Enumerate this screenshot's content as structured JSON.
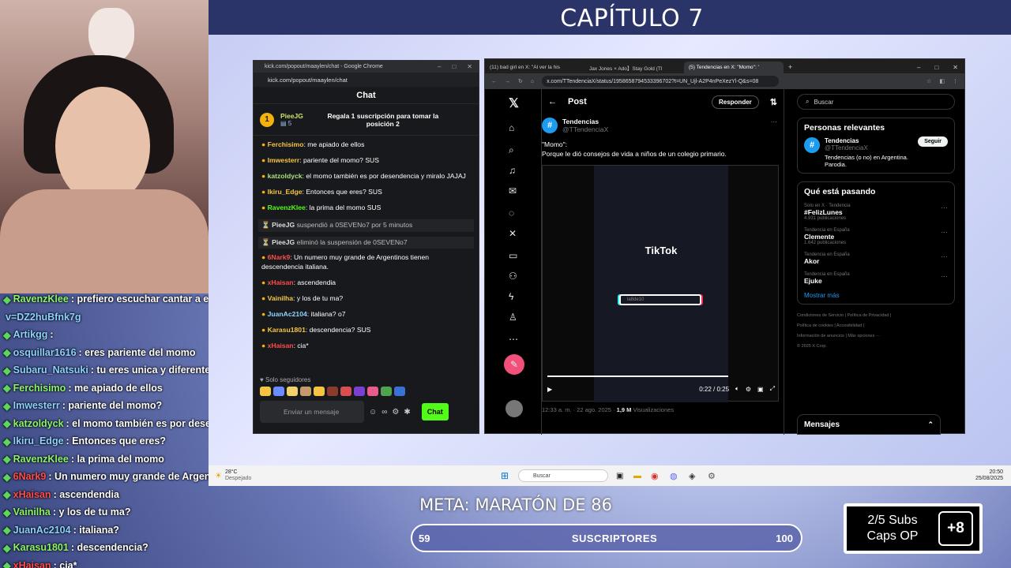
{
  "overlay": {
    "chapter": "CAPÍTULO 7",
    "goal_title": "META: MARATÓN DE 86",
    "goal_current": "59",
    "goal_label": "SUSCRIPTORES",
    "goal_target": "100",
    "goal_progress": 0.59,
    "subs_line1": "2/5 Subs",
    "subs_line2": "Caps OP",
    "subs_plus": "+8"
  },
  "stream_chat": [
    {
      "user": "RavenzKlee",
      "text": ": prefiero escuchar cantar a este",
      "color": "green"
    },
    {
      "user": "v=DZ2huBfnk7g",
      "text": "",
      "color": "plain"
    },
    {
      "user": "Artikgg",
      "text": ":",
      "color": "blue"
    },
    {
      "user": "osquillar1616",
      "text": ": eres pariente del momo",
      "color": "blue"
    },
    {
      "user": "Subaru_Natsuki",
      "text": ": tu eres unica y diferente",
      "color": "blue"
    },
    {
      "user": "Ferchisimo",
      "text": ": me apiado de ellos",
      "color": "green"
    },
    {
      "user": "Imwesterr",
      "text": ": pariente del momo?",
      "color": "blue"
    },
    {
      "user": "katzoldyck",
      "text": ": el momo también es por deser",
      "color": "green"
    },
    {
      "user": "Ikiru_Edge",
      "text": ": Entonces que eres?",
      "color": "blue"
    },
    {
      "user": "RavenzKlee",
      "text": ": la prima del momo",
      "color": "green"
    },
    {
      "user": "6Nark9",
      "text": ": Un numero muy grande de Argentino",
      "color": "red"
    },
    {
      "user": "xHaisan",
      "text": ": ascendendia",
      "color": "red"
    },
    {
      "user": "Vainilha",
      "text": ": y los de tu ma?",
      "color": "green"
    },
    {
      "user": "JuanAc2104",
      "text": ": italiana?",
      "color": "blue"
    },
    {
      "user": "Karasu1801",
      "text": ": descendencia?",
      "color": "green"
    },
    {
      "user": "xHaisan",
      "text": ": cia*",
      "color": "red"
    }
  ],
  "kick": {
    "window_title": "kick.com/popout/maaylen/chat - Google Chrome",
    "url": "kick.com/popout/maaylen/chat",
    "header": "Chat",
    "pinned_user": "PieeJG",
    "pinned_count": "5",
    "pinned_rank": "1",
    "gift_text": "Regala 1 suscripción para tomar la posición 2",
    "messages": [
      {
        "user": "Ferchisimo",
        "text": ": me apiado de ellos",
        "color": "#f5c542",
        "sys": false
      },
      {
        "user": "Imwesterr",
        "text": ": pariente del momo? SUS",
        "color": "#f5c542",
        "sys": false
      },
      {
        "user": "katzoldyck",
        "text": ": el momo también es por desendencia y miralo JAJAJ",
        "color": "#a6e07a",
        "sys": false
      },
      {
        "user": "Ikiru_Edge",
        "text": ": Entonces que eres? SUS",
        "color": "#f5c542",
        "sys": false
      },
      {
        "user": "RavenzKlee",
        "text": ": la prima del momo SUS",
        "color": "#53fc18",
        "sys": false
      },
      {
        "user": "PieeJG",
        "text": " suspendió a 0SEVENo7 por 5 minutos",
        "color": "#ddd",
        "sys": true
      },
      {
        "user": "PieeJG",
        "text": " eliminó la suspensión de 0SEVENo7",
        "color": "#ddd",
        "sys": true
      },
      {
        "user": "6Nark9",
        "text": ": Un numero muy grande de Argentinos tienen descendencia italiana.",
        "color": "#ff4d4d",
        "sys": false
      },
      {
        "user": "xHaisan",
        "text": ": ascendendia",
        "color": "#ff4d4d",
        "sys": false
      },
      {
        "user": "Vainilha",
        "text": ": y los de tu ma?",
        "color": "#f5c542",
        "sys": false
      },
      {
        "user": "JuanAc2104",
        "text": ": italiana? o7",
        "color": "#8dd3ff",
        "sys": false
      },
      {
        "user": "Karasu1801",
        "text": ": descendencia? SUS",
        "color": "#f5c542",
        "sys": false
      },
      {
        "user": "xHaisan",
        "text": ": cia*",
        "color": "#ff4d4d",
        "sys": false
      }
    ],
    "followers_only": "Solo seguidores",
    "input_placeholder": "Enviar un mensaje",
    "send_label": "Chat"
  },
  "xbrowser": {
    "tabs": [
      {
        "label": "(11) bad girl en X: \"Al ver la his"
      },
      {
        "label": "Jax Jones × Ado】Stay Gold (Tl"
      },
      {
        "label": "(5) Tendencias en X: \"Momo\": '"
      }
    ],
    "url": "x.com/TTendenciaX/status/1958658794533396702?t=UN_Ujl-A2P4nPeXezYl-Q&s=08",
    "post_header": "Post",
    "reply_label": "Responder",
    "account_name": "Tendencias",
    "account_handle": "@TTendenciaX",
    "tweet_line1": "\"Momo\":",
    "tweet_line2": "Porque le dió consejos de vida a niños de un colegio primario.",
    "video_brand": "TikTok",
    "video_search": "la8de10",
    "video_time": "0:22 / 0:25",
    "video_progress": 0.88,
    "post_time": "12:33 a. m. · 22 ago. 2025 ·",
    "post_views": "1,9 M",
    "post_views_label": "Visualizaciones",
    "search_placeholder": "Buscar",
    "relevant_title": "Personas relevantes",
    "relevant_bio": "Tendencias (o no) en Argentina. Parodia.",
    "follow_label": "Seguir",
    "trending_title": "Qué está pasando",
    "trends": [
      {
        "cat": "Solo en X · Tendencia",
        "name": "#FelizLunes",
        "count": "4.931 publicaciones"
      },
      {
        "cat": "Tendencia en España",
        "name": "Clemente",
        "count": "1.642 publicaciones"
      },
      {
        "cat": "Tendencia en España",
        "name": "Akor",
        "count": ""
      },
      {
        "cat": "Tendencia en España",
        "name": "Ejuke",
        "count": ""
      }
    ],
    "show_more": "Mostrar más",
    "legal_1": "Condiciones de Servicio | Política de Privacidad |",
    "legal_2": "Política de cookies | Accesibilidad |",
    "legal_3": "Información de anuncios | Más opciones ···",
    "legal_4": "© 2025 X Corp.",
    "messages_label": "Mensajes"
  },
  "taskbar": {
    "weather_temp": "28°C",
    "weather_desc": "Despejado",
    "search": "Buscar",
    "time": "20:50",
    "date": "25/08/2025"
  }
}
